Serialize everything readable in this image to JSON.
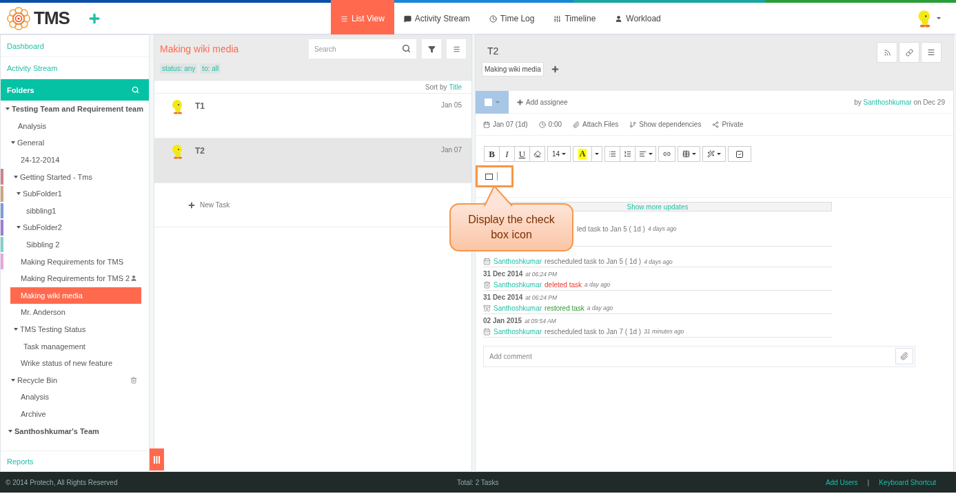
{
  "app": {
    "logo": "TMS"
  },
  "nav": [
    {
      "label": "List View",
      "selected": true
    },
    {
      "label": "Activity Stream",
      "selected": false
    },
    {
      "label": "Time Log",
      "selected": false
    },
    {
      "label": "Timeline",
      "selected": false
    },
    {
      "label": "Workload",
      "selected": false
    }
  ],
  "sidebar": {
    "links": [
      "Dashboard",
      "Activity Stream"
    ],
    "folders_title": "Folders",
    "footer_link": "Reports",
    "tree": [
      {
        "label": "Testing Team and Requirement team",
        "kind": "team",
        "selected": false,
        "expanded": true,
        "children": [
          {
            "label": "Analysis",
            "kind": "folder",
            "selected": false
          },
          {
            "label": "General",
            "kind": "folder",
            "selected": false,
            "expanded": true,
            "children": [
              {
                "label": "24-12-2014",
                "kind": "folder",
                "selected": false
              },
              {
                "label": "Getting Started - Tms",
                "kind": "folder",
                "selected": false,
                "color": "#d07f8c",
                "expanded": true,
                "children": [
                  {
                    "label": "SubFolder1",
                    "kind": "folder",
                    "selected": false,
                    "color": "#cfa57d",
                    "expanded": true,
                    "children": [
                      {
                        "label": "sibbling1",
                        "kind": "folder",
                        "selected": false,
                        "color": "#7f9ad6"
                      }
                    ]
                  },
                  {
                    "label": "SubFolder2",
                    "kind": "folder",
                    "selected": false,
                    "color": "#9a7fd1",
                    "expanded": true,
                    "children": [
                      {
                        "label": "Sibbling 2",
                        "kind": "folder",
                        "selected": false,
                        "color": "#82cfcf"
                      }
                    ]
                  }
                ]
              },
              {
                "label": "Making Requirements for TMS",
                "kind": "folder",
                "selected": false,
                "color": "#eaa3e0"
              },
              {
                "label": "Making Requirements for TMS 2",
                "kind": "shared",
                "selected": false
              },
              {
                "label": "Making wiki media",
                "kind": "folder",
                "selected": true
              },
              {
                "label": "Mr. Anderson",
                "kind": "folder",
                "selected": false
              },
              {
                "label": "TMS Testing Status",
                "kind": "folder",
                "selected": false,
                "expanded": true,
                "children": [
                  {
                    "label": "Task management",
                    "kind": "folder",
                    "selected": false
                  }
                ]
              },
              {
                "label": "Wrike status of new feature",
                "kind": "folder",
                "selected": false
              }
            ]
          },
          {
            "label": "Recycle Bin",
            "kind": "bin",
            "selected": false,
            "expanded": true,
            "children": [
              {
                "label": "Analysis",
                "kind": "folder",
                "selected": false
              },
              {
                "label": "Archive",
                "kind": "folder",
                "selected": false
              }
            ]
          }
        ]
      },
      {
        "label": "Santhoshkumar's Team",
        "kind": "team",
        "selected": false,
        "expanded": true
      }
    ]
  },
  "list": {
    "title": "Making wiki media",
    "search": {
      "placeholder": "Search"
    },
    "filters": [
      "status: any",
      "to: all"
    ],
    "sort_label": "Sort by",
    "sort_value": "Title",
    "tasks": [
      {
        "title": "T1",
        "date": "Jan 05",
        "selected": false
      },
      {
        "title": "T2",
        "date": "Jan 07",
        "selected": true
      }
    ],
    "new_task": "New Task"
  },
  "task": {
    "title": "T2",
    "folder_tag": "Making wiki media",
    "assignee": "Add assignee",
    "author_prefix": "by",
    "author": "Santhoshkumar",
    "author_suffix": "on Dec 29",
    "meta": [
      "Jan 07 (1d)",
      "0:00",
      "Attach Files",
      "Show dependencies",
      "Private"
    ],
    "editor_toolbar": {
      "bold": "B",
      "italic": "I",
      "underline": "U",
      "font_size": "14",
      "highlight": "A"
    },
    "show_more": "Show more updates",
    "updates": [
      {
        "kind": "fragment",
        "text": "led task to Jan 5 ( 1d )",
        "time": "4 days ago"
      },
      {
        "kind": "rescheduled",
        "user": "Santhoshkumar",
        "text": "rescheduled task to Jan 5 ( 1d )",
        "time": "4 days ago"
      },
      {
        "kind": "date",
        "date": "31 Dec 2014",
        "time": "at 06:24 PM"
      },
      {
        "kind": "deleted",
        "user": "Santhoshkumar",
        "text": "deleted task",
        "time": "a day ago"
      },
      {
        "kind": "date",
        "date": "31 Dec 2014",
        "time": "at 06:24 PM"
      },
      {
        "kind": "restored",
        "user": "Santhoshkumar",
        "text": "restored task",
        "time": "a day ago"
      },
      {
        "kind": "date",
        "date": "02 Jan 2015",
        "time": "at 09:54 AM"
      },
      {
        "kind": "rescheduled",
        "user": "Santhoshkumar",
        "text": "rescheduled task to Jan 7 ( 1d )",
        "time": "31 minutes ago"
      }
    ],
    "comment": {
      "placeholder": "Add comment"
    }
  },
  "callout": {
    "text": "Display the check box icon"
  },
  "footer": {
    "copyright": "© 2014 Protech, All Rights Reserved",
    "total": "Total: 2 Tasks",
    "links": [
      "Add Users",
      "Keyboard Shortcut"
    ],
    "separator": "|"
  }
}
